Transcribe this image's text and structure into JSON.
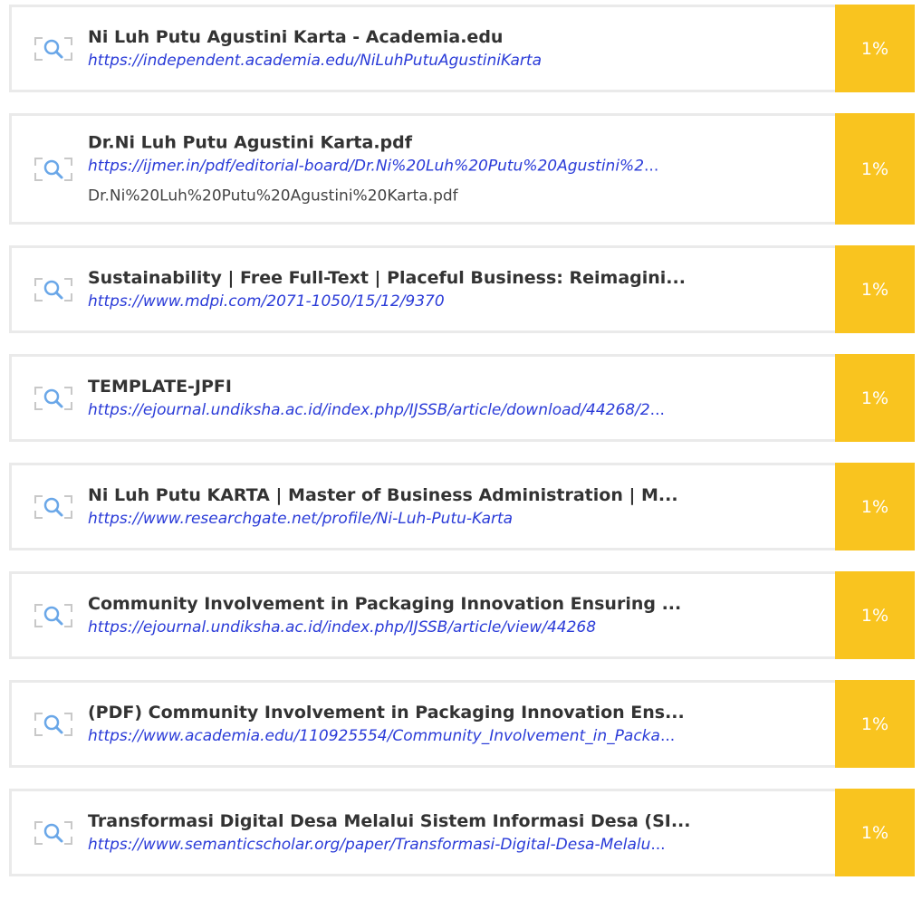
{
  "sources": [
    {
      "title": "Ni Luh Putu Agustini Karta - Academia.edu",
      "url": "https://independent.academia.edu/NiLuhPutuAgustiniKarta",
      "url_ellipsis": "",
      "extra": "",
      "percent": "1%"
    },
    {
      "title": "Dr.Ni Luh Putu Agustini Karta.pdf",
      "url": "https://ijmer.in/pdf/editorial-board/Dr.Ni%20Luh%20Putu%20Agustini%2",
      "url_ellipsis": "...",
      "extra": "Dr.Ni%20Luh%20Putu%20Agustini%20Karta.pdf",
      "percent": "1%"
    },
    {
      "title": "Sustainability | Free Full-Text | Placeful Business: Reimagini...",
      "url": "https://www.mdpi.com/2071-1050/15/12/9370",
      "url_ellipsis": "",
      "extra": "",
      "percent": "1%"
    },
    {
      "title": "TEMPLATE-JPFI",
      "url": "https://ejournal.undiksha.ac.id/index.php/IJSSB/article/download/44268/2",
      "url_ellipsis": "...",
      "extra": "",
      "percent": "1%"
    },
    {
      "title": "Ni Luh Putu KARTA | Master of Business Administration | M...",
      "url": "https://www.researchgate.net/profile/Ni-Luh-Putu-Karta",
      "url_ellipsis": "",
      "extra": "",
      "percent": "1%"
    },
    {
      "title": "Community Involvement in Packaging Innovation Ensuring ...",
      "url": "https://ejournal.undiksha.ac.id/index.php/IJSSB/article/view/44268",
      "url_ellipsis": "",
      "extra": "",
      "percent": "1%"
    },
    {
      "title": "(PDF) Community Involvement in Packaging Innovation Ens...",
      "url": "https://www.academia.edu/110925554/Community_Involvement_in_Packa",
      "url_ellipsis": "...",
      "extra": "",
      "percent": "1%"
    },
    {
      "title": "Transformasi Digital Desa Melalui Sistem Informasi Desa (SI...",
      "url": "https://www.semanticscholar.org/paper/Transformasi-Digital-Desa-Melalu",
      "url_ellipsis": "...",
      "extra": "",
      "percent": "1%"
    }
  ],
  "icon": "search-document-icon",
  "colors": {
    "accent": "#f9c41f",
    "link": "#2a3bd8",
    "border": "#eaeaea",
    "title": "#333333"
  }
}
